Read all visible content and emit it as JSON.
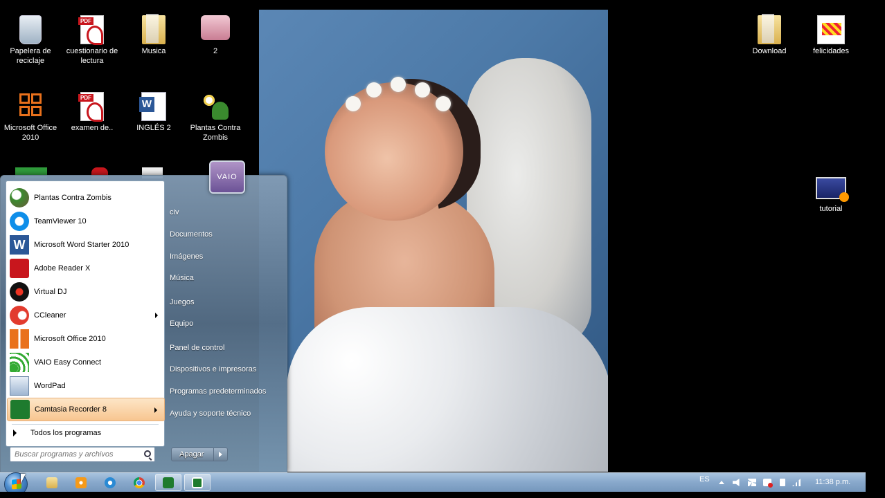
{
  "desktop": {
    "icons": [
      {
        "label": "Papelera de reciclaje",
        "icon": "recycle-bin-icon"
      },
      {
        "label": "cuestionario de lectura",
        "icon": "pdf-icon"
      },
      {
        "label": "Musica",
        "icon": "folder-icon"
      },
      {
        "label": "2",
        "icon": "image-icon"
      },
      {
        "label": "Microsoft Office 2010",
        "icon": "office-icon"
      },
      {
        "label": "examen de..",
        "icon": "pdf-icon"
      },
      {
        "label": "INGLÉS 2",
        "icon": "word-doc-icon"
      },
      {
        "label": "Plantas Contra Zombis",
        "icon": "plants-vs-zombies-icon"
      },
      {
        "label": "Download",
        "icon": "folder-icon"
      },
      {
        "label": "felicidades",
        "icon": "image-icon"
      },
      {
        "label": "tutorial",
        "icon": "video-icon"
      }
    ]
  },
  "start_menu": {
    "programs": [
      {
        "label": "Plantas Contra Zombis",
        "icon": "plants-vs-zombies-icon"
      },
      {
        "label": "TeamViewer 10",
        "icon": "teamviewer-icon"
      },
      {
        "label": "Microsoft Word Starter 2010",
        "icon": "word-icon"
      },
      {
        "label": "Adobe Reader X",
        "icon": "adobe-reader-icon"
      },
      {
        "label": "Virtual DJ",
        "icon": "virtual-dj-icon"
      },
      {
        "label": "CCleaner",
        "icon": "ccleaner-icon"
      },
      {
        "label": "Microsoft Office 2010",
        "icon": "office-icon"
      },
      {
        "label": "VAIO Easy Connect",
        "icon": "vaio-easy-connect-icon"
      },
      {
        "label": "WordPad",
        "icon": "wordpad-icon"
      },
      {
        "label": "Camtasia Recorder 8",
        "icon": "camtasia-icon"
      }
    ],
    "all_programs": "Todos los programas",
    "search_placeholder": "Buscar programas y archivos",
    "user_tile": "VAIO",
    "right_items": [
      "civ",
      "Documentos",
      "Imágenes",
      "Música",
      "Juegos",
      "Equipo",
      "Panel de control",
      "Dispositivos e impresoras",
      "Programas predeterminados",
      "Ayuda y soporte técnico"
    ],
    "shutdown_label": "Apagar"
  },
  "taskbar": {
    "pinned": [
      "explorer-icon",
      "media-player-icon",
      "internet-explorer-icon",
      "chrome-icon",
      "camtasia-studio-icon",
      "camtasia-recorder-icon"
    ],
    "language": "ES",
    "clock": "11:38 p.m."
  },
  "colors": {
    "taskbar": "#8aaacd",
    "menu_hover": "#f8c690"
  }
}
